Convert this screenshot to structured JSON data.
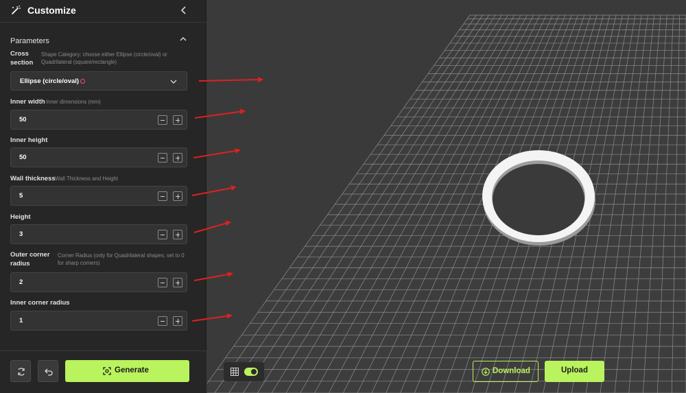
{
  "header": {
    "title": "Customize"
  },
  "parameters": {
    "section_label": "Parameters",
    "cross_section": {
      "label_line1": "Cross",
      "label_line2": "section",
      "desc_line1": "Shape Category: choose either Ellipse (circle/oval) or",
      "desc_line2": "Quadrilateral (square/rectangle)",
      "selected": "Ellipse (circle/oval)"
    },
    "inner_width": {
      "label": "Inner width",
      "desc": "Inner dimensions (mm)",
      "value": "50"
    },
    "inner_height": {
      "label": "Inner height",
      "value": "50"
    },
    "wall_thickness": {
      "label": "Wall thickness",
      "desc": "Wall Thickness and Height",
      "value": "5"
    },
    "height": {
      "label": "Height",
      "value": "3"
    },
    "outer_corner_radius": {
      "label_line1": "Outer corner",
      "label_line2": "radius",
      "desc_line1": "Corner Radius (only for Quadrilateral shapes; set to 0",
      "desc_line2": "for sharp corners)",
      "value": "2"
    },
    "inner_corner_radius": {
      "label": "Inner corner radius",
      "value": "1"
    }
  },
  "actions": {
    "generate": "Generate",
    "download": "Download",
    "upload": "Upload"
  },
  "colors": {
    "accent": "#b9f35d",
    "annotation_arrow": "#e02020",
    "sidebar_bg": "#262626",
    "viewport_bg": "#3a3a3a"
  }
}
